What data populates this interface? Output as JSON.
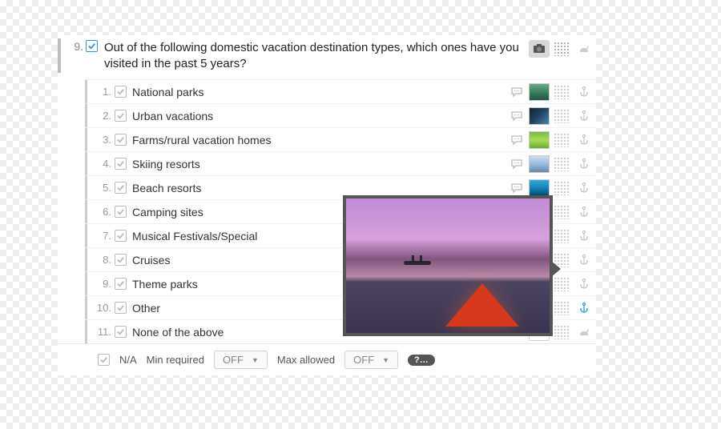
{
  "question": {
    "number": "9.",
    "text": "Out of the following domestic vacation destination types, which ones have you visited in the past 5 years?"
  },
  "options": [
    {
      "n": "1.",
      "label": "National parks"
    },
    {
      "n": "2.",
      "label": "Urban vacations"
    },
    {
      "n": "3.",
      "label": "Farms/rural vacation homes"
    },
    {
      "n": "4.",
      "label": "Skiing resorts"
    },
    {
      "n": "5.",
      "label": "Beach resorts"
    },
    {
      "n": "6.",
      "label": "Camping sites"
    },
    {
      "n": "7.",
      "label": "Musical Festivals/Special"
    },
    {
      "n": "8.",
      "label": "Cruises"
    },
    {
      "n": "9.",
      "label": "Theme parks"
    },
    {
      "n": "10.",
      "label": "Other"
    },
    {
      "n": "11.",
      "label": "None of the above"
    }
  ],
  "thumb_styles": [
    "linear-gradient(180deg,#6a8 0%,#375 60%,#254 100%)",
    "linear-gradient(135deg,#123 0%,#246 50%,#48a 100%)",
    "linear-gradient(180deg,#7b4 0%,#ad5 50%,#6a3 100%)",
    "linear-gradient(180deg,#cde 0%,#9bd 50%,#68a 100%)",
    "linear-gradient(180deg,#3ad 0%,#17a 60%,#046 100%)",
    "linear-gradient(180deg,#c7a 0%,#a56 50%,#534 100%)",
    "linear-gradient(135deg,#f44 0%,#fa0 40%,#06f 100%)",
    "linear-gradient(180deg,#bde 0%,#8be 50%,#48b 100%)",
    "linear-gradient(180deg,#84d 0%,#52a 50%,#317 100%)"
  ],
  "footer": {
    "na": "N/A",
    "min_label": "Min required",
    "min_value": "OFF",
    "max_label": "Max allowed",
    "max_value": "OFF",
    "help": "?…"
  }
}
